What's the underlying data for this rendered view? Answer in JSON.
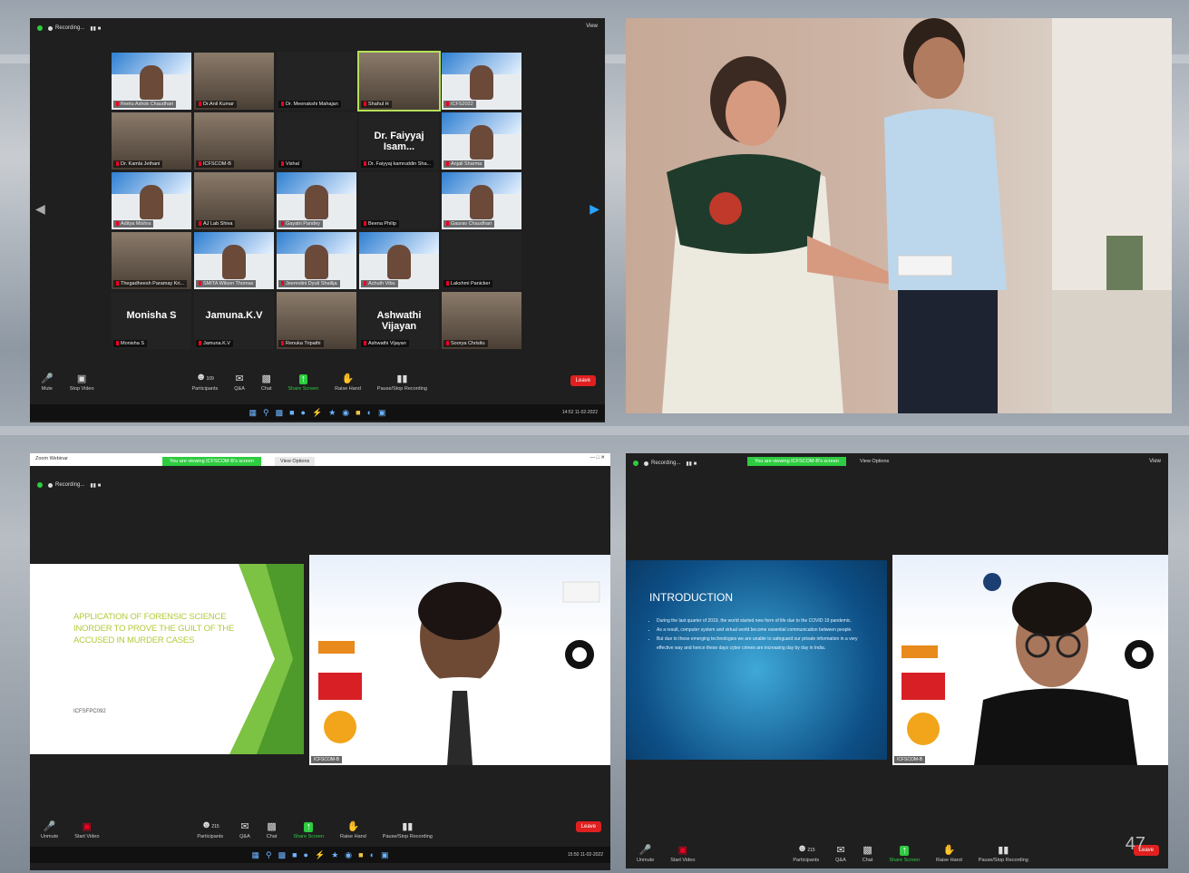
{
  "page_number": "47",
  "panel1": {
    "recording_label": "Recording...",
    "view_label": "View",
    "participants": [
      {
        "name": "Reetu Ashok Chaudhari",
        "type": "banner"
      },
      {
        "name": "Dr.Anil Kumar",
        "type": "photo"
      },
      {
        "name": "Dr. Meenakshi Mahajan",
        "type": "dark"
      },
      {
        "name": "Shahul H",
        "type": "photo",
        "active": true
      },
      {
        "name": "ICFS2022",
        "type": "banner"
      },
      {
        "name": "Dr. Kamla Jethani",
        "type": "photo"
      },
      {
        "name": "ICFSCOM-B",
        "type": "photo"
      },
      {
        "name": "Vishal",
        "type": "dark"
      },
      {
        "name": "Dr. Faiyyaj kamruddin Sha...",
        "type": "namecard",
        "bigname": "Dr. Faiyyaj  Isam..."
      },
      {
        "name": "Anjali Sharma",
        "type": "banner"
      },
      {
        "name": "Aditya Mishra",
        "type": "banner"
      },
      {
        "name": "AJ Lab Shiva",
        "type": "photo"
      },
      {
        "name": "Gayatri Pandey",
        "type": "banner"
      },
      {
        "name": "Beena Philip",
        "type": "dark"
      },
      {
        "name": "Gaurav Chaudhari",
        "type": "banner"
      },
      {
        "name": "Thegadheesh Paramay Kri...",
        "type": "photo"
      },
      {
        "name": "SMITA Wilson Thomas",
        "type": "banner"
      },
      {
        "name": "Jeemolini Dyuti Shailija",
        "type": "banner"
      },
      {
        "name": "Achuth Vibu",
        "type": "banner"
      },
      {
        "name": "Lakshmi Panicker",
        "type": "dark"
      },
      {
        "name": "Monisha S",
        "type": "namecard",
        "bigname": "Monisha S"
      },
      {
        "name": "Jamuna.K.V",
        "type": "namecard",
        "bigname": "Jamuna.K.V"
      },
      {
        "name": "Renuka Tripathi",
        "type": "photo"
      },
      {
        "name": "Ashwathi Vijayan",
        "type": "namecard",
        "bigname": "Ashwathi Vijayan"
      },
      {
        "name": "Soorya Chrisitu",
        "type": "photo"
      }
    ],
    "toolbar": {
      "mute": "Mute",
      "stop_video": "Stop Video",
      "participants": "Participants",
      "participants_count": "109",
      "qa": "Q&A",
      "chat": "Chat",
      "share_screen": "Share Screen",
      "raise_hand": "Raise Hand",
      "pause_recording": "Pause/Stop Recording",
      "leave": "Leave"
    },
    "clock": "14:52  11-02-2022"
  },
  "panel3": {
    "window_title": "Zoom Webinar",
    "sharing_banner": "You are viewing ICFSCOM-B's screen",
    "view_options": "View Options",
    "recording_label": "Recording...",
    "slide_title": "APPLICATION OF FORENSIC SCIENCE INORDER TO PROVE THE GUILT OF THE ACCUSED IN MURDER CASES",
    "slide_id": "ICFSFPC092",
    "speaker_label": "ICFSCOM-B",
    "toolbar": {
      "unmute": "Unmute",
      "start_video": "Start Video",
      "participants": "Participants",
      "participants_count": "215",
      "qa": "Q&A",
      "chat": "Chat",
      "share_screen": "Share Screen",
      "raise_hand": "Raise Hand",
      "pause_recording": "Pause/Stop Recording",
      "leave": "Leave"
    },
    "clock": "15:50  11-02-2022"
  },
  "panel4": {
    "sharing_banner": "You are viewing ICFSCOM-B's screen",
    "view_options": "View Options",
    "recording_label": "Recording...",
    "view_label": "View",
    "slide_heading": "INTRODUCTION",
    "bullets": [
      "During the last quarter of 2019, the world started new form of life due to the COVID 19 pandemic.",
      "As a result, computer system and virtual world become essential communication between people.",
      "But due to these emerging technologies we are unable to safeguard our private information in a very effective way and hence these days cyber crimes are increasing day by day in India."
    ],
    "speaker_label": "ICFSCOM-B",
    "toolbar": {
      "unmute": "Unmute",
      "start_video": "Start Video",
      "participants": "Participants",
      "participants_count": "215",
      "qa": "Q&A",
      "chat": "Chat",
      "share_screen": "Share Screen",
      "raise_hand": "Raise Hand",
      "pause_recording": "Pause/Stop Recording",
      "leave": "Leave"
    }
  }
}
